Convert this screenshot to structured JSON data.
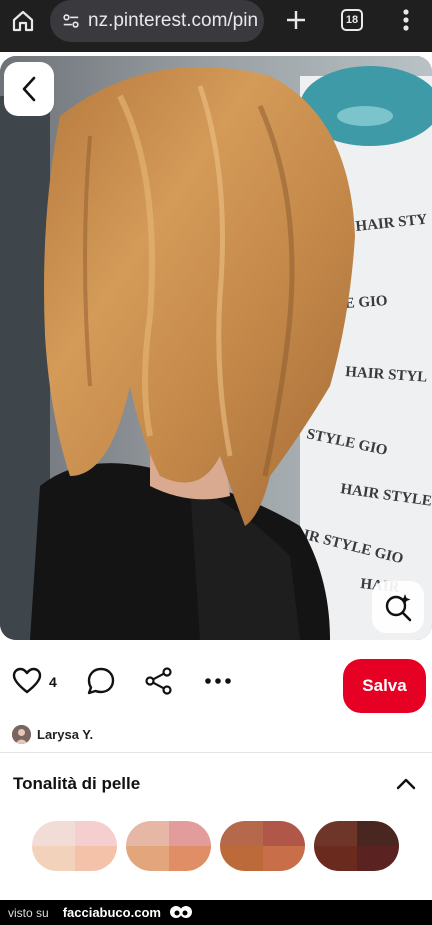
{
  "browser": {
    "url": "nz.pinterest.com/pin/",
    "tab_count": "18"
  },
  "pin": {
    "photo_wall_texts": [
      "HAIR STY",
      "E GIO",
      "HAIR STYL",
      "STYLE GIO",
      "HAIR STYLE",
      "AIR STYLE GIO",
      "HAIR"
    ],
    "like_count": "4",
    "save_label": "Salva"
  },
  "author": {
    "name": "Larysa Y."
  },
  "skin_tone": {
    "title": "Tonalità di pelle",
    "swatches": [
      {
        "colors": [
          "#f1ddd6",
          "#f5cfd0",
          "#f3d2bb",
          "#f4c2a8"
        ]
      },
      {
        "colors": [
          "#e6b7a4",
          "#e29c9c",
          "#e3a57b",
          "#df8e66"
        ]
      },
      {
        "colors": [
          "#b5684a",
          "#b0574a",
          "#bd6a3a",
          "#c86f4a"
        ]
      },
      {
        "colors": [
          "#6e3628",
          "#4a2620",
          "#6b2a1e",
          "#5a2220"
        ]
      }
    ]
  },
  "watermark": {
    "prefix": "visto su",
    "site": "facciabuco.com"
  },
  "colors": {
    "save_red": "#e60023",
    "browser_bar": "#1f1f1f",
    "url_pill": "#3a3a3e"
  }
}
